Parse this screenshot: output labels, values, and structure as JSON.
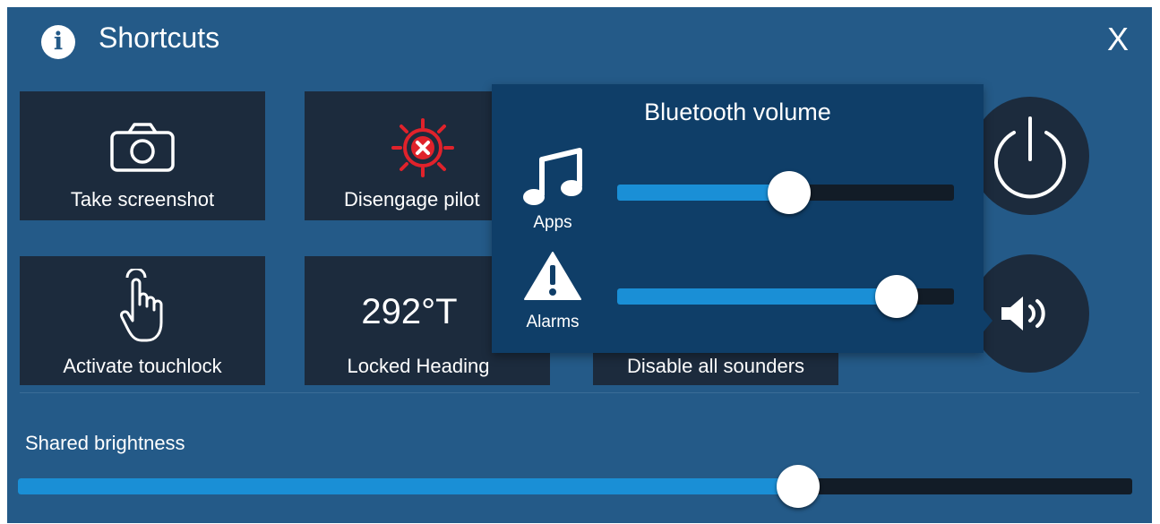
{
  "header": {
    "title": "Shortcuts",
    "close_label": "X"
  },
  "tiles": [
    {
      "label": "Take screenshot",
      "icon": "camera-icon"
    },
    {
      "label": "Disengage pilot",
      "icon": "pilot-disengage-icon"
    },
    {
      "value": "292°T",
      "label": "Locked Heading"
    },
    {
      "label": "Activate touchlock",
      "icon": "touch-hand-icon"
    },
    {
      "label": "Disable all sounders",
      "icon": "sounder-icon"
    }
  ],
  "side_buttons": [
    {
      "name": "power-button",
      "icon": "power-icon"
    },
    {
      "name": "volume-button",
      "icon": "speaker-icon"
    }
  ],
  "bluetooth_volume": {
    "title": "Bluetooth volume",
    "apps": {
      "label": "Apps",
      "icon": "music-note-icon",
      "level": 0.51
    },
    "alarms": {
      "label": "Alarms",
      "icon": "warning-icon",
      "level": 0.83
    }
  },
  "brightness": {
    "label": "Shared brightness",
    "level": 0.7
  },
  "colors": {
    "panel": "#245a88",
    "tile": "#1c2b3d",
    "popup": "#0f3e68",
    "accent": "#1a8fd6",
    "pilot_red": "#e0222b"
  }
}
